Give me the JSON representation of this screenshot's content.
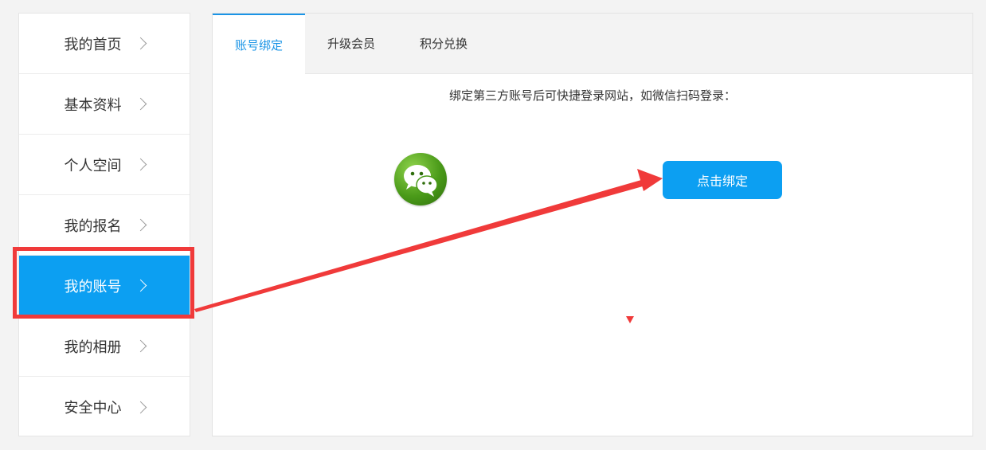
{
  "sidebar": {
    "items": [
      {
        "label": "我的首页"
      },
      {
        "label": "基本资料"
      },
      {
        "label": "个人空间"
      },
      {
        "label": "我的报名"
      },
      {
        "label": "我的账号"
      },
      {
        "label": "我的相册"
      },
      {
        "label": "安全中心"
      }
    ],
    "active_index": 4
  },
  "tabs": [
    {
      "label": "账号绑定"
    },
    {
      "label": "升级会员"
    },
    {
      "label": "积分兑换"
    }
  ],
  "content": {
    "description": "绑定第三方账号后可快捷登录网站，如微信扫码登录：",
    "wechat_icon": "wechat-icon",
    "bind_button_label": "点击绑定"
  },
  "colors": {
    "accent": "#0c9ff2",
    "tab_active": "#1a94e6",
    "annotation_red": "#f03a3a"
  }
}
